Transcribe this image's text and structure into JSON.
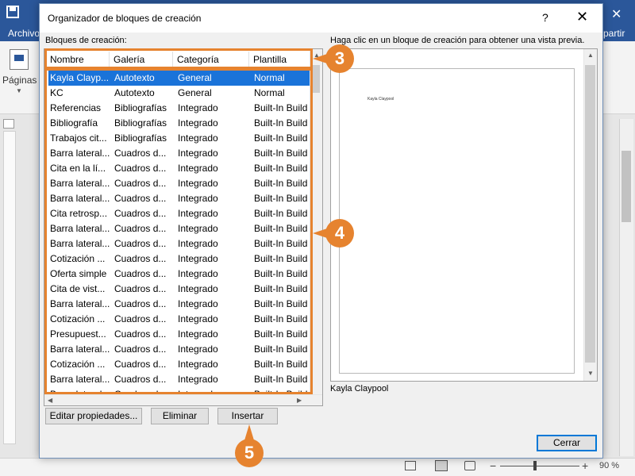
{
  "word": {
    "tab_file": "Archivo",
    "tab_share": "partir",
    "pages_label": "Páginas",
    "zoom_level": "90 %",
    "zoom_minus": "−",
    "zoom_plus": "+"
  },
  "dialog": {
    "title": "Organizador de bloques de creación",
    "help": "?",
    "close": "✕",
    "blocks_label": "Bloques de creación:",
    "preview_label": "Haga clic en un bloque de creación para obtener una vista previa.",
    "preview_text": "Kayla Claypool",
    "preview_caption": "Kayla Claypool",
    "columns": [
      "Nombre",
      "Galería",
      "Categoría",
      "Plantilla"
    ],
    "rows": [
      [
        "Kayla Clayp...",
        "Autotexto",
        "General",
        "Normal"
      ],
      [
        "KC",
        "Autotexto",
        "General",
        "Normal"
      ],
      [
        "Referencias",
        "Bibliografías",
        "Integrado",
        "Built-In Build"
      ],
      [
        "Bibliografía",
        "Bibliografías",
        "Integrado",
        "Built-In Build"
      ],
      [
        "Trabajos cit...",
        "Bibliografías",
        "Integrado",
        "Built-In Build"
      ],
      [
        "Barra lateral...",
        "Cuadros d...",
        "Integrado",
        "Built-In Build"
      ],
      [
        "Cita en la lí...",
        "Cuadros d...",
        "Integrado",
        "Built-In Build"
      ],
      [
        "Barra lateral...",
        "Cuadros d...",
        "Integrado",
        "Built-In Build"
      ],
      [
        "Barra lateral...",
        "Cuadros d...",
        "Integrado",
        "Built-In Build"
      ],
      [
        "Cita retrosp...",
        "Cuadros d...",
        "Integrado",
        "Built-In Build"
      ],
      [
        "Barra lateral...",
        "Cuadros d...",
        "Integrado",
        "Built-In Build"
      ],
      [
        "Barra lateral...",
        "Cuadros d...",
        "Integrado",
        "Built-In Build"
      ],
      [
        "Cotización ...",
        "Cuadros d...",
        "Integrado",
        "Built-In Build"
      ],
      [
        "Oferta simple",
        "Cuadros d...",
        "Integrado",
        "Built-In Build"
      ],
      [
        "Cita de vist...",
        "Cuadros d...",
        "Integrado",
        "Built-In Build"
      ],
      [
        "Barra lateral...",
        "Cuadros d...",
        "Integrado",
        "Built-In Build"
      ],
      [
        "Cotización ...",
        "Cuadros d...",
        "Integrado",
        "Built-In Build"
      ],
      [
        "Presupuest...",
        "Cuadros d...",
        "Integrado",
        "Built-In Build"
      ],
      [
        "Barra lateral...",
        "Cuadros d...",
        "Integrado",
        "Built-In Build"
      ],
      [
        "Cotización ...",
        "Cuadros d...",
        "Integrado",
        "Built-In Build"
      ],
      [
        "Barra lateral...",
        "Cuadros d...",
        "Integrado",
        "Built-In Build"
      ],
      [
        "Barra lateral...",
        "Cuadros d...",
        "Integrado",
        "Built-In Build"
      ]
    ],
    "selected_row": 0,
    "buttons": {
      "edit": "Editar propiedades...",
      "delete": "Eliminar",
      "insert": "Insertar",
      "close": "Cerrar"
    }
  },
  "annotations": {
    "callout_3": "3",
    "callout_4": "4",
    "callout_5": "5",
    "accent_color": "#e6832f"
  },
  "colors": {
    "word_blue": "#2b579a",
    "selection_blue": "#1a73d9"
  }
}
